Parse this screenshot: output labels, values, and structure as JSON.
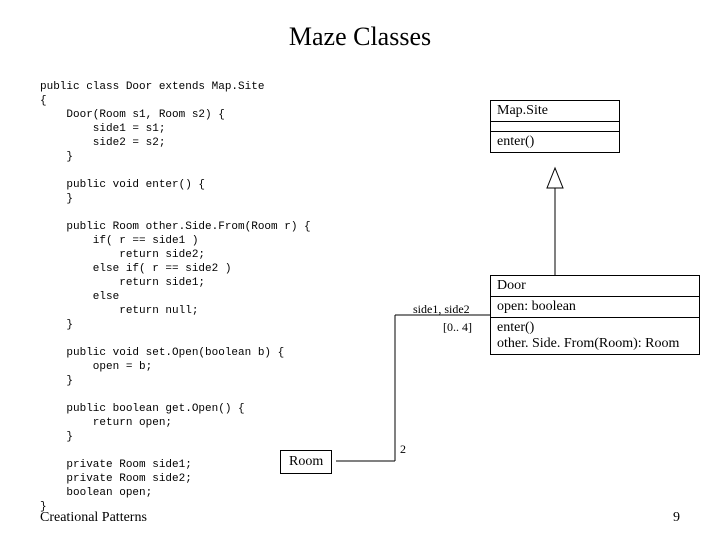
{
  "title": "Maze Classes",
  "code": "public class Door extends Map.Site\n{\n    Door(Room s1, Room s2) {\n        side1 = s1;\n        side2 = s2;\n    }\n\n    public void enter() {\n    }\n\n    public Room other.Side.From(Room r) {\n        if( r == side1 )\n            return side2;\n        else if( r == side2 )\n            return side1;\n        else\n            return null;\n    }\n\n    public void set.Open(boolean b) {\n        open = b;\n    }\n\n    public boolean get.Open() {\n        return open;\n    }\n\n    private Room side1;\n    private Room side2;\n    boolean open;\n}",
  "uml": {
    "mapsite": {
      "name": "Map.Site",
      "op": "enter()"
    },
    "door": {
      "name": "Door",
      "attr": "open: boolean",
      "op1": "enter()",
      "op2": "other. Side. From(Room): Room"
    },
    "room": {
      "name": "Room"
    }
  },
  "assoc": {
    "role_label": "side1, side2",
    "mult_near_door": "[0.. 4]",
    "mult_near_room": "2"
  },
  "footer": {
    "left": "Creational Patterns",
    "right": "9"
  }
}
